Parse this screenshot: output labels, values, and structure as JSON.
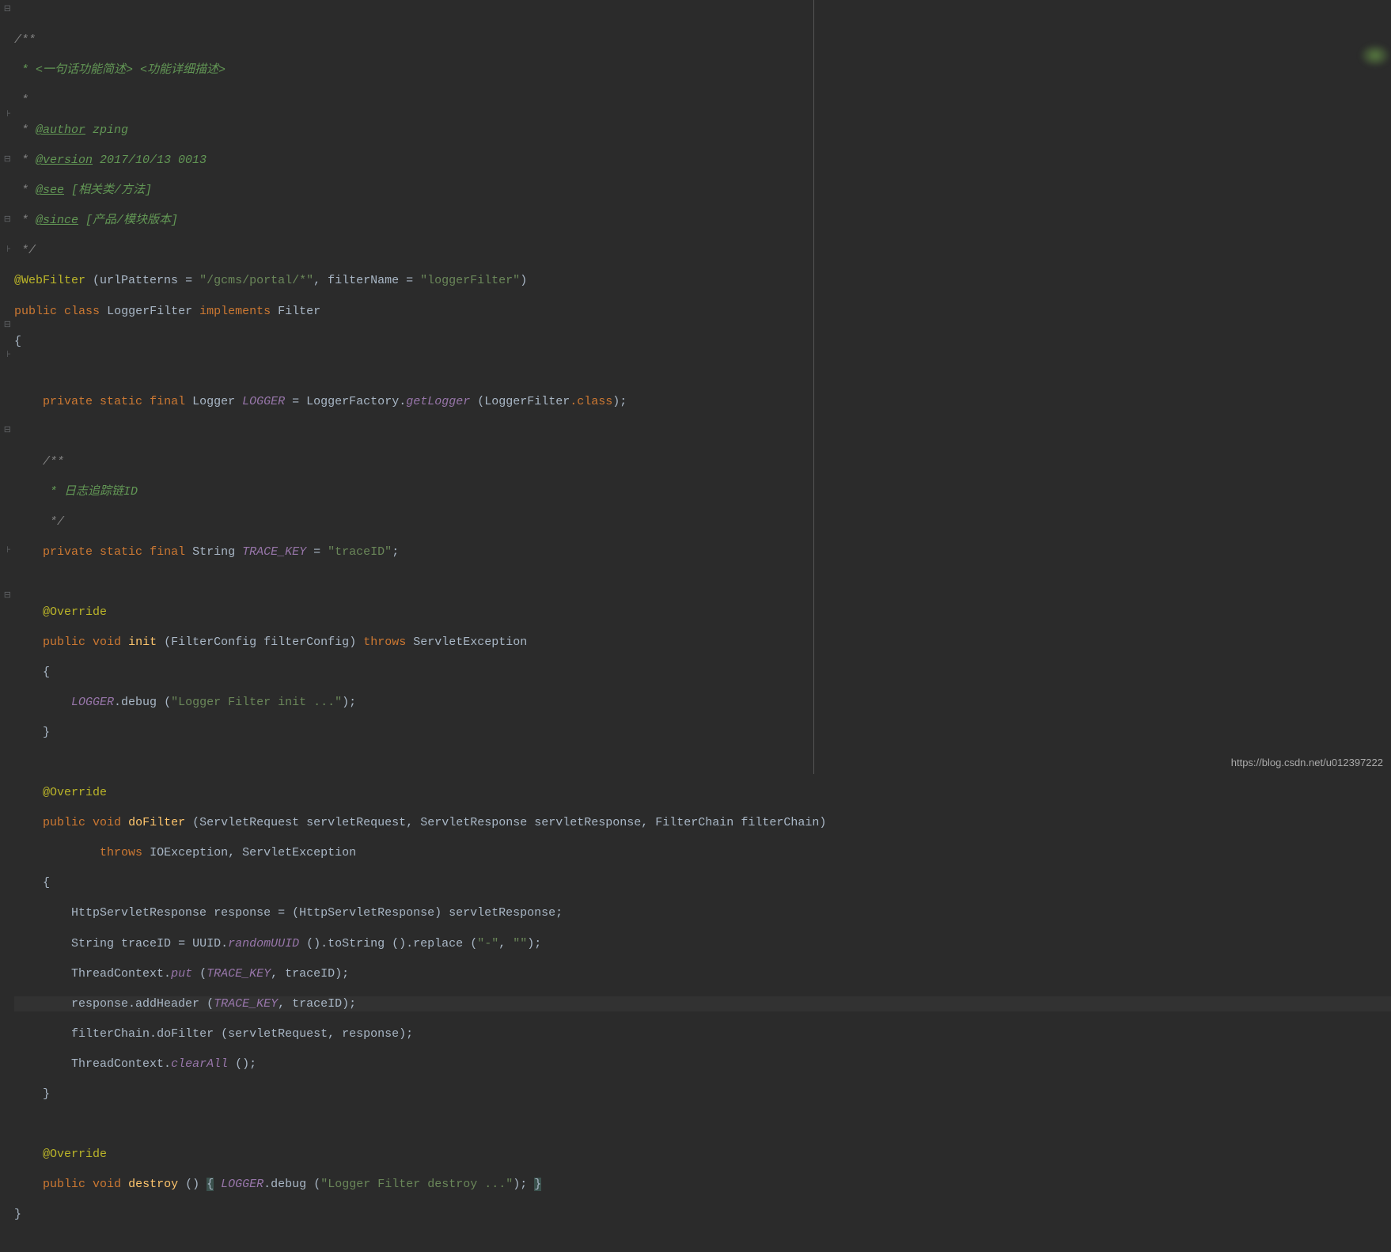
{
  "code": {
    "comment_start": "/**",
    "comment_desc": " * <一句话功能简述> <功能详细描述>",
    "comment_empty": " *",
    "comment_author_tag": "@author",
    "comment_author_val": " zping",
    "comment_version_tag": "@version",
    "comment_version_val": " 2017/10/13 0013",
    "comment_see_tag": "@see",
    "comment_see_val": " [相关类/方法]",
    "comment_since_tag": "@since",
    "comment_since_val": " [产品/模块版本]",
    "comment_end": " */",
    "webfilter_anno": "@WebFilter",
    "webfilter_url_param": "urlPatterns",
    "webfilter_url_val": "\"/gcms/portal/*\"",
    "webfilter_name_param": "filterName",
    "webfilter_name_val": "\"loggerFilter\"",
    "public_kw": "public",
    "class_kw": "class",
    "class_name": "LoggerFilter",
    "implements_kw": "implements",
    "filter_name": "Filter",
    "private_kw": "private",
    "static_kw": "static",
    "final_kw": "final",
    "logger_type": "Logger",
    "logger_field": "LOGGER",
    "logger_factory": "LoggerFactory",
    "getlogger_method": "getLogger",
    "logger_class_ref": "LoggerFilter",
    "class_suffix": ".class",
    "trace_comment_start": "/**",
    "trace_comment_desc": " * 日志追踪链ID",
    "trace_comment_end": " */",
    "string_type": "String",
    "trace_key_field": "TRACE_KEY",
    "trace_key_val": "\"traceID\"",
    "override_anno": "@Override",
    "void_kw": "void",
    "init_method": "init",
    "filterconfig_type": "FilterConfig",
    "filterconfig_param": "filterConfig",
    "throws_kw": "throws",
    "servletexception": "ServletException",
    "debug_method": "debug",
    "init_msg": "\"Logger Filter init ...\"",
    "dofilter_method": "doFilter",
    "servletreq_type": "ServletRequest",
    "servletreq_param": "servletRequest",
    "servletresp_type": "ServletResponse",
    "servletresp_param": "servletResponse",
    "filterchain_type": "FilterChain",
    "filterchain_param": "filterChain",
    "ioexception": "IOException",
    "httpresp_type": "HttpServletResponse",
    "response_var": "response",
    "traceid_var": "traceID",
    "uuid_class": "UUID",
    "randomuuid_method": "randomUUID",
    "tostring_method": "toString",
    "replace_method": "replace",
    "dash_str": "\"-\"",
    "empty_str": "\"\"",
    "threadcontext": "ThreadContext",
    "put_method": "put",
    "addheader_method": "addHeader",
    "clearall_method": "clearAll",
    "destroy_method": "destroy",
    "destroy_msg": "\"Logger Filter destroy ...\""
  },
  "watermark": "https://blog.csdn.net/u012397222"
}
